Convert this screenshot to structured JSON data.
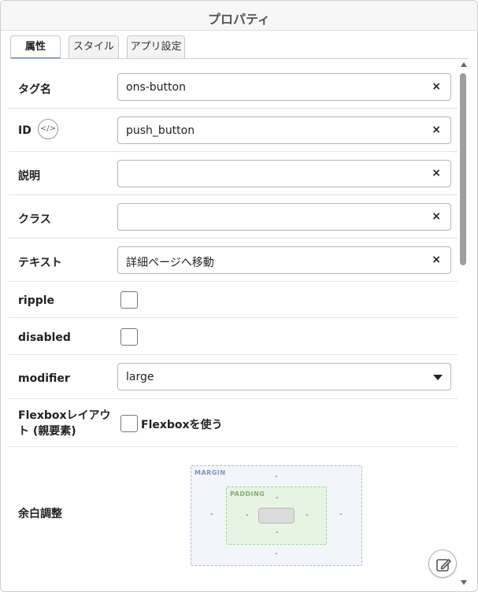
{
  "panel": {
    "title": "プロパティ"
  },
  "tabs": [
    {
      "label": "属性",
      "active": true
    },
    {
      "label": "スタイル",
      "active": false
    },
    {
      "label": "アプリ設定",
      "active": false
    }
  ],
  "rows": {
    "tag_name": {
      "label": "タグ名",
      "value": "ons-button"
    },
    "id": {
      "label": "ID",
      "value": "push_button",
      "icon": "code-icon"
    },
    "description": {
      "label": "説明",
      "value": ""
    },
    "class": {
      "label": "クラス",
      "value": ""
    },
    "text": {
      "label": "テキスト",
      "value": "詳細ページへ移動"
    },
    "ripple": {
      "label": "ripple",
      "checked": false
    },
    "disabled": {
      "label": "disabled",
      "checked": false
    },
    "modifier": {
      "label": "modifier",
      "value": "large"
    },
    "flexbox": {
      "label": "Flexboxレイアウト (親要素)",
      "checkbox_label": "Flexboxを使う",
      "checked": false
    },
    "spacing": {
      "label": "余白調整",
      "margin_label": "MARGIN",
      "padding_label": "PADDING",
      "margin": {
        "top": "-",
        "right": "-",
        "bottom": "-",
        "left": "-"
      },
      "padding": {
        "top": "-",
        "right": "-",
        "bottom": "-",
        "left": "-"
      }
    }
  },
  "clear_glyph": "×",
  "colors": {
    "active_tab_underline": "#3a78c6",
    "margin_box": "#f2f5f9",
    "padding_box": "#e8f4e3"
  }
}
